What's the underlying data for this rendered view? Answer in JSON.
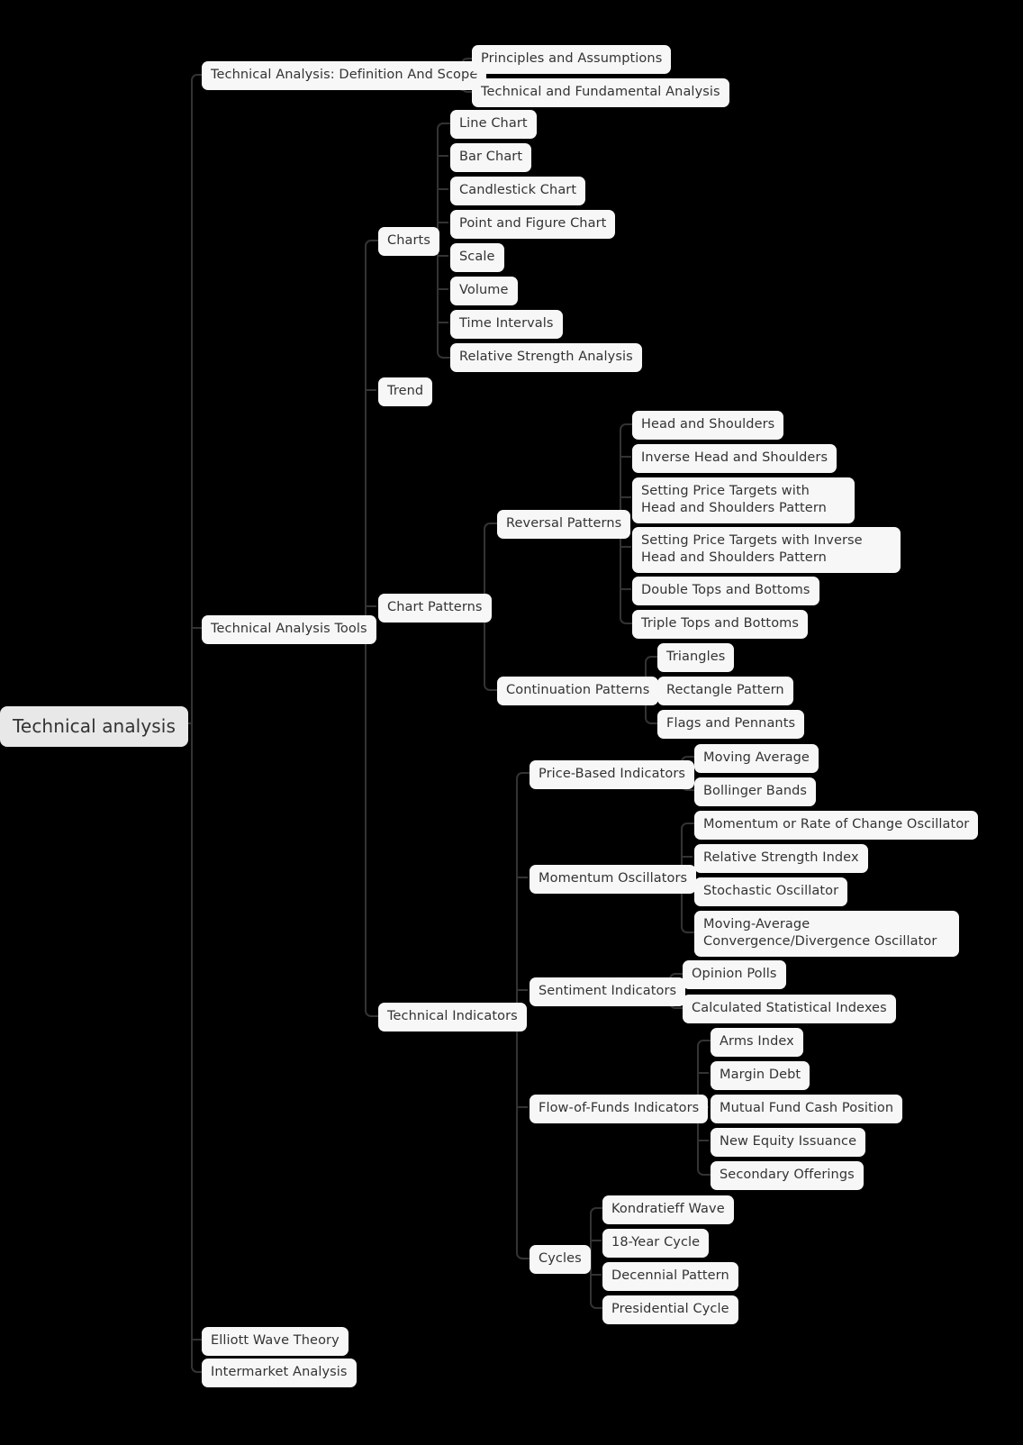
{
  "diagram": {
    "type": "mindmap",
    "orientation": "left-to-right",
    "background_color": "#000000",
    "node_color": "#f7f7f7",
    "root_node_color": "#e8e8e8",
    "text_color": "#333333",
    "connector_color": "#333333",
    "root": "Technical analysis"
  },
  "nodes": {
    "root": "Technical analysis",
    "l1": {
      "definition_scope": "Technical Analysis: Definition And Scope",
      "tools": "Technical Analysis Tools",
      "elliott": "Elliott Wave Theory",
      "intermarket": "Intermarket Analysis"
    },
    "definition_children": [
      "Principles and Assumptions",
      "Technical and Fundamental Analysis"
    ],
    "tools_children": {
      "charts": "Charts",
      "trend": "Trend",
      "chart_patterns": "Chart Patterns",
      "technical_indicators": "Technical Indicators"
    },
    "charts_children": [
      "Line Chart",
      "Bar Chart",
      "Candlestick Chart",
      "Point and Figure Chart",
      "Scale",
      "Volume",
      "Time Intervals",
      "Relative Strength Analysis"
    ],
    "chart_patterns_children": {
      "reversal": "Reversal Patterns",
      "continuation": "Continuation Patterns"
    },
    "reversal_children": [
      "Head and Shoulders",
      "Inverse Head and Shoulders",
      "Setting Price Targets with Head and Shoulders Pattern",
      "Setting Price Targets with Inverse Head and Shoulders Pattern",
      "Double Tops and Bottoms",
      "Triple Tops and Bottoms"
    ],
    "continuation_children": [
      "Triangles",
      "Rectangle Pattern",
      "Flags and Pennants"
    ],
    "indicators_children": {
      "price_based": "Price-Based Indicators",
      "momentum": "Momentum Oscillators",
      "sentiment": "Sentiment Indicators",
      "flow_of_funds": "Flow-of-Funds Indicators",
      "cycles": "Cycles"
    },
    "price_based_children": [
      "Moving Average",
      "Bollinger Bands"
    ],
    "momentum_children": [
      "Momentum or Rate of Change Oscillator",
      "Relative Strength Index",
      "Stochastic Oscillator",
      "Moving-Average Convergence/Divergence Oscillator"
    ],
    "sentiment_children": [
      "Opinion Polls",
      "Calculated Statistical Indexes"
    ],
    "flow_of_funds_children": [
      "Arms Index",
      "Margin Debt",
      "Mutual Fund Cash Position",
      "New Equity Issuance",
      "Secondary Offerings"
    ],
    "cycles_children": [
      "Kondratieff Wave",
      "18-Year Cycle",
      "Decennial Pattern",
      "Presidential Cycle"
    ]
  }
}
